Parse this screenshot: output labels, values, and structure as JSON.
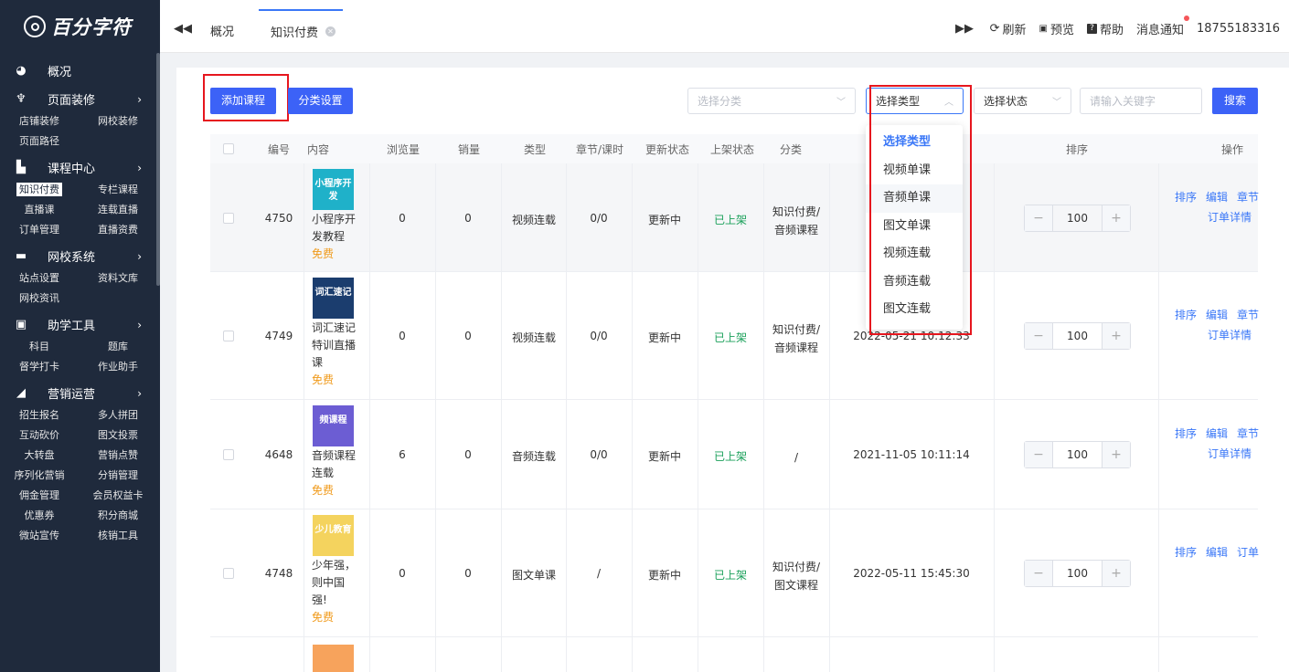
{
  "brand": {
    "name": "百分字符"
  },
  "sidebar": {
    "sections": [
      {
        "label": "概况",
        "icon": "pie-chart-icon",
        "items": []
      },
      {
        "label": "页面装修",
        "icon": "brush-icon",
        "items": [
          "店铺装修",
          "网校装修",
          "页面路径"
        ]
      },
      {
        "label": "课程中心",
        "icon": "bookmark-icon",
        "items": [
          "知识付费",
          "专栏课程",
          "直播课",
          "连载直播",
          "订单管理",
          "直播资费"
        ]
      },
      {
        "label": "网校系统",
        "icon": "monitor-icon",
        "items": [
          "站点设置",
          "资料文库",
          "网校资讯"
        ]
      },
      {
        "label": "助学工具",
        "icon": "briefcase-icon",
        "items": [
          "科目",
          "题库",
          "督学打卡",
          "作业助手"
        ]
      },
      {
        "label": "营销运营",
        "icon": "megaphone-icon",
        "items": [
          "招生报名",
          "多人拼团",
          "互动砍价",
          "图文投票",
          "大转盘",
          "营销点赞",
          "序列化营销",
          "分销管理",
          "佣金管理",
          "会员权益卡",
          "优惠券",
          "积分商城",
          "微站宣传",
          "核销工具"
        ]
      }
    ],
    "active_item": "知识付费"
  },
  "topbar": {
    "tabs": [
      {
        "label": "概况"
      },
      {
        "label": "知识付费"
      }
    ],
    "refresh": "刷新",
    "preview": "预览",
    "help": "帮助",
    "notifications": "消息通知",
    "phone": "18755183316"
  },
  "toolbar": {
    "add_course": "添加课程",
    "category_settings": "分类设置",
    "filter_category_placeholder": "选择分类",
    "filter_type": "选择类型",
    "filter_status": "选择状态",
    "keyword_placeholder": "请输入关键字",
    "search": "搜索"
  },
  "type_dropdown": {
    "options": [
      "选择类型",
      "视频单课",
      "音频单课",
      "图文单课",
      "视频连载",
      "音频连载",
      "图文连载"
    ],
    "selected": "选择类型",
    "hovered": "音频单课"
  },
  "table": {
    "headers": [
      "编号",
      "内容",
      "浏览量",
      "销量",
      "类型",
      "章节/课时",
      "更新状态",
      "上架状态",
      "分类",
      "排序",
      "操作"
    ],
    "rows": [
      {
        "id": "4750",
        "name": [
          "小程序开",
          "发教程"
        ],
        "price": "免费",
        "views": "0",
        "sales": "0",
        "type": "视频连载",
        "chapters": "0/0",
        "update": "更新中",
        "status": "已上架",
        "category": [
          "知识付费/",
          "音频课程"
        ],
        "time": "",
        "sort": "100",
        "ops": [
          "排序",
          "编辑",
          "章节"
        ],
        "ops2": "订单详情",
        "thumb_text": "小程序开发"
      },
      {
        "id": "4749",
        "name": [
          "词汇速记",
          "特训直播",
          "课"
        ],
        "price": "免费",
        "views": "0",
        "sales": "0",
        "type": "视频连载",
        "chapters": "0/0",
        "update": "更新中",
        "status": "已上架",
        "category": [
          "知识付费/",
          "音频课程"
        ],
        "time": "2022-05-21 10:12:33",
        "sort": "100",
        "ops": [
          "排序",
          "编辑",
          "章节"
        ],
        "ops2": "订单详情",
        "thumb_text": "词汇速记"
      },
      {
        "id": "4648",
        "name": [
          "音频课程",
          "连载"
        ],
        "price": "免费",
        "views": "6",
        "sales": "0",
        "type": "音频连载",
        "chapters": "0/0",
        "update": "更新中",
        "status": "已上架",
        "category": [
          "/"
        ],
        "time": "2021-11-05 10:11:14",
        "sort": "100",
        "ops": [
          "排序",
          "编辑",
          "章节"
        ],
        "ops2": "订单详情",
        "thumb_text": "频课程"
      },
      {
        "id": "4748",
        "name": [
          "少年强，",
          "则中国",
          "强!"
        ],
        "price": "免费",
        "views": "0",
        "sales": "0",
        "type": "图文单课",
        "chapters": "/",
        "update": "更新中",
        "status": "已上架",
        "category": [
          "知识付费/",
          "图文课程"
        ],
        "time": "2022-05-11 15:45:30",
        "sort": "100",
        "ops": [
          "排序",
          "编辑",
          "订单"
        ],
        "ops2": "",
        "thumb_text": "少儿教育"
      }
    ]
  },
  "colors": {
    "primary": "#3c62f7",
    "sidebar_bg": "#1f2a3c",
    "success": "#1aa05a",
    "free": "#f09a1b",
    "highlight": "#e6161e"
  }
}
